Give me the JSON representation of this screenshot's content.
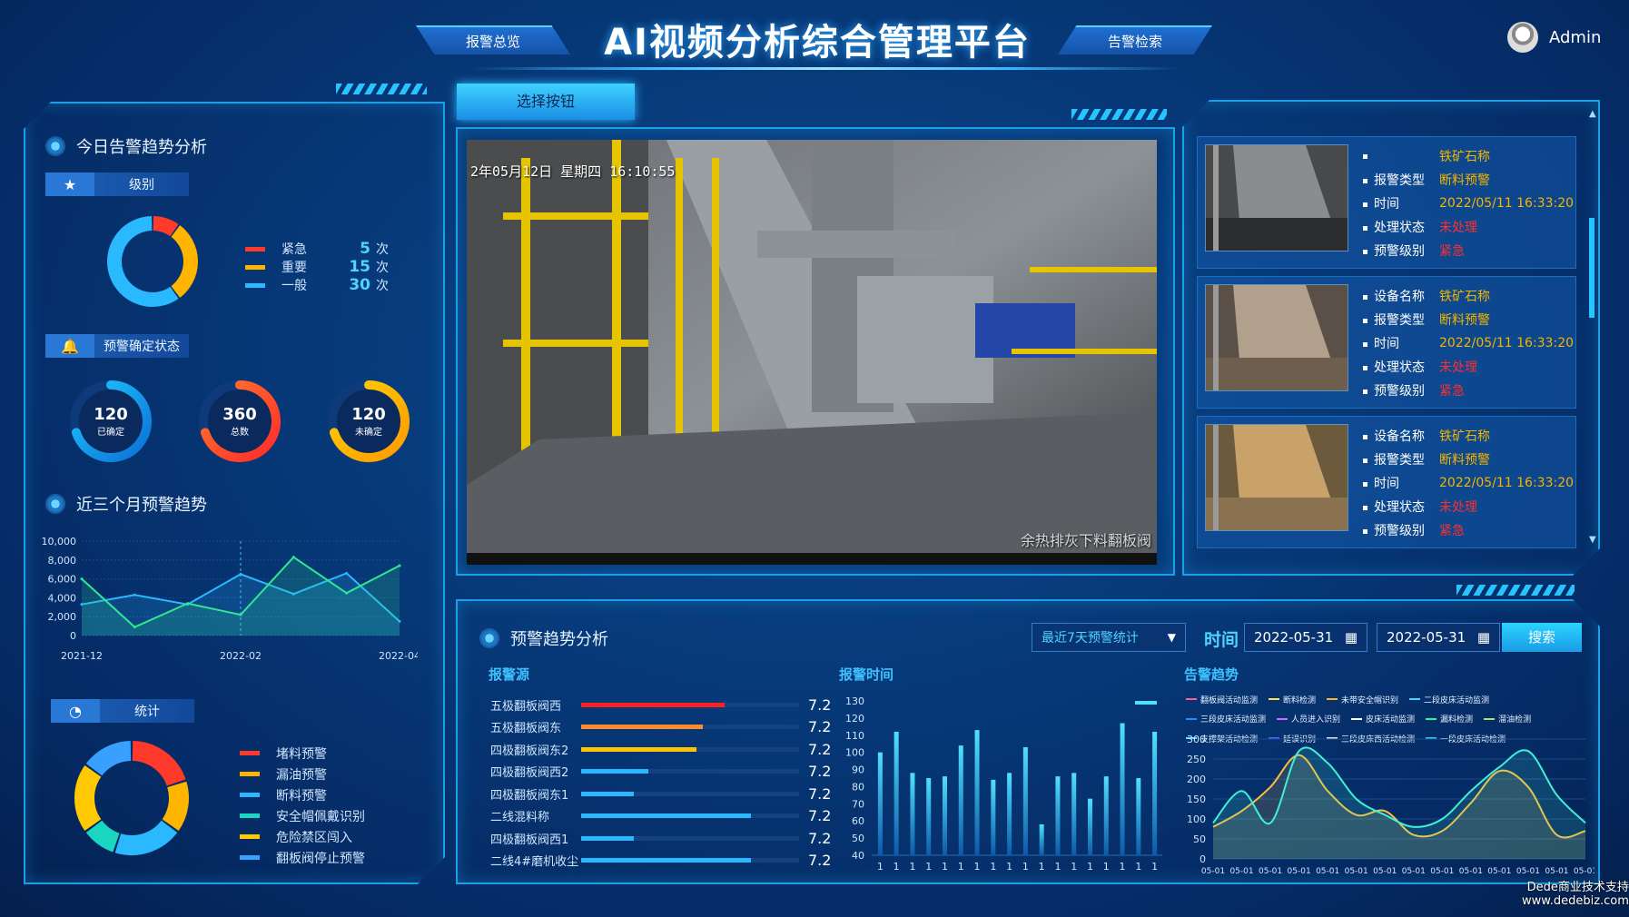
{
  "header": {
    "title": "AI视频分析综合管理平台",
    "nav_left": "报警总览",
    "nav_right": "告警检索",
    "user": "Admin"
  },
  "today": {
    "title": "今日告警趋势分析",
    "level_label": "级别",
    "levels": [
      {
        "name": "紧急",
        "count": "5",
        "unit": "次",
        "color": "#ff3a2a",
        "value": 5
      },
      {
        "name": "重要",
        "count": "15",
        "unit": "次",
        "color": "#ffb400",
        "value": 15
      },
      {
        "name": "一般",
        "count": "30",
        "unit": "次",
        "color": "#2ab8ff",
        "value": 30
      }
    ],
    "confirm_label": "预警确定状态",
    "rings": [
      {
        "num": "120",
        "label": "已确定",
        "frac": 0.7,
        "c1": "#1ec8ff",
        "c2": "#0c6fd6"
      },
      {
        "num": "360",
        "label": "总数",
        "frac": 0.7,
        "c1": "#ff7a2a",
        "c2": "#ff2a2a"
      },
      {
        "num": "120",
        "label": "未确定",
        "frac": 0.7,
        "c1": "#ffd000",
        "c2": "#ff9a00"
      }
    ]
  },
  "chart_data": [
    {
      "type": "area",
      "title": "近三个月预警趋势",
      "x": [
        "2021-12",
        "",
        "",
        "",
        "2022-02",
        "",
        "",
        "",
        "2022-04"
      ],
      "yticks": [
        "10,000",
        "8,000",
        "6,000",
        "4,000",
        "2,000",
        "0"
      ],
      "ylim": [
        0,
        10000
      ],
      "series": [
        {
          "color": "#2ab8ff",
          "values": [
            3300,
            4300,
            3300,
            6500,
            4400,
            6600,
            1500
          ]
        },
        {
          "color": "#30e890",
          "values": [
            6000,
            900,
            3400,
            2200,
            8300,
            4500,
            7400
          ]
        }
      ]
    },
    {
      "type": "bar",
      "title": "报警时间",
      "yticks": [
        "130",
        "120",
        "110",
        "100",
        "90",
        "80",
        "70",
        "60",
        "50",
        "40"
      ],
      "ylim": [
        40,
        130
      ],
      "categories": [
        "1",
        "1",
        "1",
        "1",
        "1",
        "1",
        "1",
        "1",
        "1",
        "1",
        "1",
        "1",
        "1",
        "1",
        "1",
        "1",
        "1",
        "1"
      ],
      "values": [
        100,
        112,
        88,
        85,
        86,
        104,
        113,
        84,
        88,
        103,
        58,
        86,
        88,
        73,
        86,
        117,
        85,
        112
      ]
    },
    {
      "type": "line",
      "title": "告警趋势",
      "yticks": [
        "300",
        "250",
        "200",
        "150",
        "100",
        "50",
        "0"
      ],
      "ylim": [
        0,
        300
      ],
      "categories": [
        "05-01",
        "05-01",
        "05-01",
        "05-01",
        "05-01",
        "05-01",
        "05-01",
        "05-01",
        "05-01",
        "05-01",
        "05-01",
        "05-01",
        "05-01",
        "05-01"
      ],
      "series": [
        {
          "color": "#ffbe3b",
          "values": [
            80,
            120,
            180,
            260,
            170,
            110,
            120,
            60,
            70,
            140,
            220,
            180,
            60,
            70
          ]
        },
        {
          "color": "#40f0d6",
          "values": [
            90,
            170,
            90,
            270,
            240,
            150,
            110,
            80,
            100,
            170,
            230,
            270,
            160,
            90
          ]
        }
      ],
      "legend": [
        "翻板阀活动监测",
        "断料检测",
        "未带安全帽识别",
        "二段皮床活动监测",
        "三段皮床活动监测",
        "人员进入识别",
        "皮床活动监测",
        "漏料检测",
        "溜油检测",
        "支撑架活动检测",
        "延误识别",
        "三段皮床西活动检测",
        "一段皮床活动检测"
      ],
      "legend_colors": [
        "#ff5e8e",
        "#ffe14a",
        "#ffb41e",
        "#3ed5ff",
        "#2a8cff",
        "#d06bff",
        "#ffffff",
        "#35f08a",
        "#9fe866",
        "#4de6ff",
        "#3a6bff",
        "#e0e0e0",
        "#34c6ff"
      ]
    }
  ],
  "stats": {
    "label": "统计",
    "items": [
      {
        "name": "堵料预警",
        "color": "#ff3a2a",
        "value": 20
      },
      {
        "name": "漏油预警",
        "color": "#ffb400",
        "value": 15
      },
      {
        "name": "断料预警",
        "color": "#2ab8ff",
        "value": 20
      },
      {
        "name": "安全帽佩戴识别",
        "color": "#1ad6c0",
        "value": 10
      },
      {
        "name": "危险禁区闯入",
        "color": "#ffc800",
        "value": 20
      },
      {
        "name": "翻板阀停止预警",
        "color": "#3aa0ff",
        "value": 15
      }
    ]
  },
  "video": {
    "select_button": "选择按钮",
    "overlay_time": "2年05月12日  星期四  16:10:55",
    "caption": "余热排灰下料翻板阀"
  },
  "alarms": [
    {
      "fields": [
        {
          "k": "",
          "v": "铁矿石称"
        },
        {
          "k": "报警类型",
          "v": "断料预警"
        },
        {
          "k": "时间",
          "v": "2022/05/11 16:33:20"
        },
        {
          "k": "处理状态",
          "v": "未处理",
          "red": true
        },
        {
          "k": "预警级别",
          "v": "紧急",
          "red": true
        }
      ]
    },
    {
      "fields": [
        {
          "k": "设备名称",
          "v": "铁矿石称"
        },
        {
          "k": "报警类型",
          "v": "断料预警"
        },
        {
          "k": "时间",
          "v": "2022/05/11 16:33:20"
        },
        {
          "k": "处理状态",
          "v": "未处理",
          "red": true
        },
        {
          "k": "预警级别",
          "v": "紧急",
          "red": true
        }
      ]
    },
    {
      "fields": [
        {
          "k": "设备名称",
          "v": "铁矿石称"
        },
        {
          "k": "报警类型",
          "v": "断料预警"
        },
        {
          "k": "时间",
          "v": "2022/05/11 16:33:20"
        },
        {
          "k": "处理状态",
          "v": "未处理",
          "red": true
        },
        {
          "k": "预警级别",
          "v": "紧急",
          "red": true
        }
      ]
    }
  ],
  "trend": {
    "title": "预警趋势分析",
    "select": "最近7天预警统计",
    "time_label": "时间",
    "date_from": "2022-05-31",
    "date_to": "2022-05-31",
    "search": "搜索",
    "source_title": "报警源",
    "sources": [
      {
        "name": "五极翻板阀西",
        "val": "7.2",
        "frac": 0.66,
        "color": "#ff2020"
      },
      {
        "name": "五极翻板阀东",
        "val": "7.2",
        "frac": 0.56,
        "color": "#ff8a2a"
      },
      {
        "name": "四极翻板阀东2",
        "val": "7.2",
        "frac": 0.53,
        "color": "#ffc400"
      },
      {
        "name": "四极翻板阀西2",
        "val": "7.2",
        "frac": 0.31,
        "color": "#2ab8ff"
      },
      {
        "name": "四极翻板阀东1",
        "val": "7.2",
        "frac": 0.24,
        "color": "#2ab8ff"
      },
      {
        "name": "二线混料称",
        "val": "7.2",
        "frac": 0.78,
        "color": "#2ab8ff"
      },
      {
        "name": "四极翻板阀西1",
        "val": "7.2",
        "frac": 0.24,
        "color": "#2ab8ff"
      },
      {
        "name": "二线4#磨机收尘",
        "val": "7.2",
        "frac": 0.78,
        "color": "#2ab8ff"
      }
    ]
  },
  "watermark": {
    "line1": "Dede商业技术支持",
    "line2": "www.dedebiz.com"
  }
}
